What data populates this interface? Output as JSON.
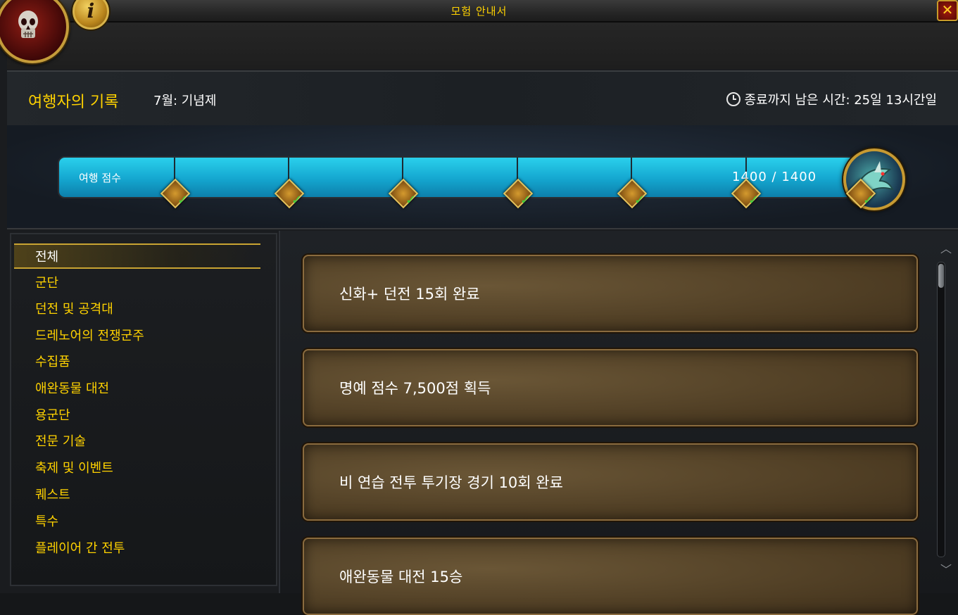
{
  "window": {
    "title": "모험 안내서",
    "close_label": "✕",
    "info_label": "i"
  },
  "header": {
    "title": "여행자의 기록",
    "subtitle": "7월: 기념제",
    "timer_text": "종료까지 남은 시간: 25일 13시간일"
  },
  "progress": {
    "label": "여행 점수",
    "value_text": "1400 / 1400",
    "current": 1400,
    "max": 1400,
    "milestones_completed": 7
  },
  "categories": [
    {
      "label": "전체",
      "selected": true
    },
    {
      "label": "군단"
    },
    {
      "label": "던전 및 공격대"
    },
    {
      "label": "드레노어의 전쟁군주"
    },
    {
      "label": "수집품"
    },
    {
      "label": "애완동물 대전"
    },
    {
      "label": "용군단"
    },
    {
      "label": "전문 기술"
    },
    {
      "label": "축제 및 이벤트"
    },
    {
      "label": "퀘스트"
    },
    {
      "label": "특수"
    },
    {
      "label": "플레이어 간 전투"
    }
  ],
  "activities": [
    {
      "label": "신화+ 던전 15회 완료"
    },
    {
      "label": "명예 점수 7,500점 획득"
    },
    {
      "label": "비 연습 전투 투기장 경기 10회 완료"
    },
    {
      "label": "애완동물 대전 15승"
    }
  ],
  "colors": {
    "accent": "#ffd200",
    "progress": "#1fb7dd",
    "check": "#3cd23c"
  }
}
